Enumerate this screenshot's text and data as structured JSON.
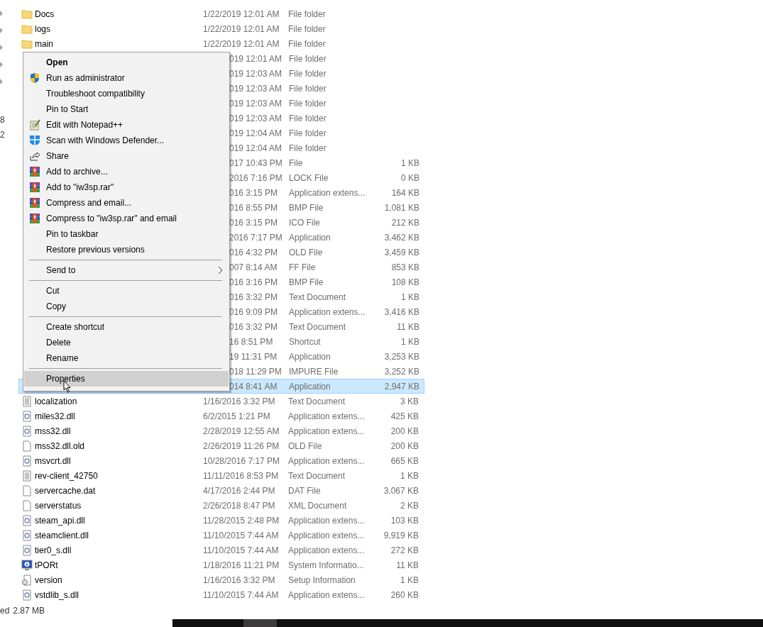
{
  "nav_pane": {
    "labels": [
      "8",
      "2"
    ]
  },
  "files": [
    {
      "kind": "folder",
      "name": "Docs",
      "date": "1/22/2019 12:01 AM",
      "type": "File folder",
      "selected": false
    },
    {
      "kind": "folder",
      "name": "logs",
      "date": "1/22/2019 12:01 AM",
      "type": "File folder",
      "selected": false
    },
    {
      "kind": "folder",
      "name": "main",
      "date": "1/22/2019 12:01 AM",
      "type": "File folder",
      "selected": false
    },
    {
      "kind": "covered",
      "date": "019 12:01 AM",
      "type": "File folder",
      "selected": false
    },
    {
      "kind": "covered",
      "date": "019 12:03 AM",
      "type": "File folder",
      "selected": false
    },
    {
      "kind": "covered",
      "date": "019 12:03 AM",
      "type": "File folder",
      "selected": false
    },
    {
      "kind": "covered",
      "date": "019 12:03 AM",
      "type": "File folder",
      "selected": false
    },
    {
      "kind": "covered",
      "date": "019 12:03 AM",
      "type": "File folder",
      "selected": false
    },
    {
      "kind": "covered",
      "date": "019 12:04 AM",
      "type": "File folder",
      "selected": false
    },
    {
      "kind": "covered",
      "date": "019 12:04 AM",
      "type": "File folder",
      "selected": false
    },
    {
      "kind": "covered",
      "date": "017 10:43 PM",
      "type": "File",
      "size": "1 KB",
      "selected": false
    },
    {
      "kind": "covered",
      "date": "2016 7:16 PM",
      "type": "LOCK File",
      "size": "0 KB",
      "selected": false
    },
    {
      "kind": "covered",
      "date": "016 3:15 PM",
      "type": "Application extens...",
      "size": "164 KB",
      "selected": false
    },
    {
      "kind": "covered",
      "date": "016 8:55 PM",
      "type": "BMP File",
      "size": "1,081 KB",
      "selected": false
    },
    {
      "kind": "covered",
      "date": "016 3:15 PM",
      "type": "ICO File",
      "size": "212 KB",
      "selected": false
    },
    {
      "kind": "covered",
      "date": "2016 7:17 PM",
      "type": "Application",
      "size": "3,462 KB",
      "selected": false
    },
    {
      "kind": "covered",
      "date": "016 4:32 PM",
      "type": "OLD File",
      "size": "3,459 KB",
      "selected": false
    },
    {
      "kind": "covered",
      "date": "007 8:14 AM",
      "type": "FF File",
      "size": "853 KB",
      "selected": false
    },
    {
      "kind": "covered",
      "date": "016 3:16 PM",
      "type": "BMP File",
      "size": "108 KB",
      "selected": false
    },
    {
      "kind": "covered",
      "date": "016 3:32 PM",
      "type": "Text Document",
      "size": "1 KB",
      "selected": false
    },
    {
      "kind": "covered",
      "date": "016 9:09 PM",
      "type": "Application extens...",
      "size": "3,416 KB",
      "selected": false
    },
    {
      "kind": "covered",
      "date": "016 3:32 PM",
      "type": "Text Document",
      "size": "11 KB",
      "selected": false
    },
    {
      "kind": "covered",
      "date": "16 8:51 PM",
      "type": "Shortcut",
      "size": "1 KB",
      "selected": false
    },
    {
      "kind": "covered",
      "date": "19 11:31 PM",
      "type": "Application",
      "size": "3,253 KB",
      "selected": false
    },
    {
      "kind": "covered",
      "date": "018 11:29 PM",
      "type": "IMPURE File",
      "size": "3,252 KB",
      "selected": false
    },
    {
      "kind": "covered",
      "date": "014 8:41 AM",
      "type": "Application",
      "size": "2,947 KB",
      "selected": true
    },
    {
      "kind": "text",
      "name": "localization",
      "date": "1/16/2016 3:32 PM",
      "type": "Text Document",
      "size": "3 KB",
      "selected": false
    },
    {
      "kind": "dll",
      "name": "miles32.dll",
      "date": "6/2/2015 1:21 PM",
      "type": "Application extens...",
      "size": "425 KB",
      "selected": false
    },
    {
      "kind": "dll",
      "name": "mss32.dll",
      "date": "2/28/2019 12:55 AM",
      "type": "Application extens...",
      "size": "200 KB",
      "selected": false
    },
    {
      "kind": "blank",
      "name": "mss32.dll.old",
      "date": "2/26/2019 11:26 PM",
      "type": "OLD File",
      "size": "200 KB",
      "selected": false
    },
    {
      "kind": "dll",
      "name": "msvcrt.dll",
      "date": "10/28/2016 7:17 PM",
      "type": "Application extens...",
      "size": "665 KB",
      "selected": false
    },
    {
      "kind": "text",
      "name": "rev-client_42750",
      "date": "11/11/2016 8:53 PM",
      "type": "Text Document",
      "size": "1 KB",
      "selected": false
    },
    {
      "kind": "blank",
      "name": "servercache.dat",
      "date": "4/17/2016 2:44 PM",
      "type": "DAT File",
      "size": "3,067 KB",
      "selected": false
    },
    {
      "kind": "blank",
      "name": "serverstatus",
      "date": "2/26/2018 8:47 PM",
      "type": "XML Document",
      "size": "2 KB",
      "selected": false
    },
    {
      "kind": "dll",
      "name": "steam_api.dll",
      "date": "11/28/2015 2:48 PM",
      "type": "Application extens...",
      "size": "103 KB",
      "selected": false
    },
    {
      "kind": "dll",
      "name": "steamclient.dll",
      "date": "11/10/2015 7:44 AM",
      "type": "Application extens...",
      "size": "9,919 KB",
      "selected": false
    },
    {
      "kind": "dll",
      "name": "tier0_s.dll",
      "date": "11/10/2015 7:44 AM",
      "type": "Application extens...",
      "size": "272 KB",
      "selected": false
    },
    {
      "kind": "sysinfo",
      "name": "tPORt",
      "date": "1/18/2016 11:21 PM",
      "type": "System Informatio...",
      "size": "11 KB",
      "selected": false
    },
    {
      "kind": "setup",
      "name": "version",
      "date": "1/16/2016 3:32 PM",
      "type": "Setup Information",
      "size": "1 KB",
      "selected": false
    },
    {
      "kind": "dll",
      "name": "vstdlib_s.dll",
      "date": "11/10/2015 7:44 AM",
      "type": "Application extens...",
      "size": "260 KB",
      "selected": false
    }
  ],
  "context_menu": {
    "groups": [
      [
        {
          "label": "Open",
          "kind": "plain",
          "default": true,
          "submenu": false,
          "selected": false
        },
        {
          "label": "Run as administrator",
          "kind": "admin",
          "default": false,
          "submenu": false,
          "selected": false
        },
        {
          "label": "Troubleshoot compatibility",
          "kind": "plain",
          "default": false,
          "submenu": false,
          "selected": false
        },
        {
          "label": "Pin to Start",
          "kind": "plain",
          "default": false,
          "submenu": false,
          "selected": false
        },
        {
          "label": "Edit with Notepad++",
          "kind": "notepad",
          "default": false,
          "submenu": false,
          "selected": false
        },
        {
          "label": "Scan with Windows Defender...",
          "kind": "scan",
          "default": false,
          "submenu": false,
          "selected": false
        },
        {
          "label": "Share",
          "kind": "share",
          "default": false,
          "submenu": false,
          "selected": false
        },
        {
          "label": "Add to archive...",
          "kind": "archive",
          "default": false,
          "submenu": false,
          "selected": false
        },
        {
          "label": "Add to \"iw3sp.rar\"",
          "kind": "archive",
          "default": false,
          "submenu": false,
          "selected": false
        },
        {
          "label": "Compress and email...",
          "kind": "archive",
          "default": false,
          "submenu": false,
          "selected": false
        },
        {
          "label": "Compress to \"iw3sp.rar\" and email",
          "kind": "archive",
          "default": false,
          "submenu": false,
          "selected": false
        },
        {
          "label": "Pin to taskbar",
          "kind": "plain",
          "default": false,
          "submenu": false,
          "selected": false
        },
        {
          "label": "Restore previous versions",
          "kind": "plain",
          "default": false,
          "submenu": false,
          "selected": false
        }
      ],
      [
        {
          "label": "Send to",
          "kind": "plain",
          "default": false,
          "submenu": true,
          "selected": false
        }
      ],
      [
        {
          "label": "Cut",
          "kind": "plain",
          "default": false,
          "submenu": false,
          "selected": false
        },
        {
          "label": "Copy",
          "kind": "plain",
          "default": false,
          "submenu": false,
          "selected": false
        }
      ],
      [
        {
          "label": "Create shortcut",
          "kind": "plain",
          "default": false,
          "submenu": false,
          "selected": false
        },
        {
          "label": "Delete",
          "kind": "plain",
          "default": false,
          "submenu": false,
          "selected": false
        },
        {
          "label": "Rename",
          "kind": "plain",
          "default": false,
          "submenu": false,
          "selected": false
        }
      ],
      [
        {
          "label": "Properties",
          "kind": "plain",
          "default": false,
          "submenu": false,
          "selected": true
        }
      ]
    ]
  },
  "status_bar": {
    "label": "ed",
    "size": "2.87 MB"
  }
}
